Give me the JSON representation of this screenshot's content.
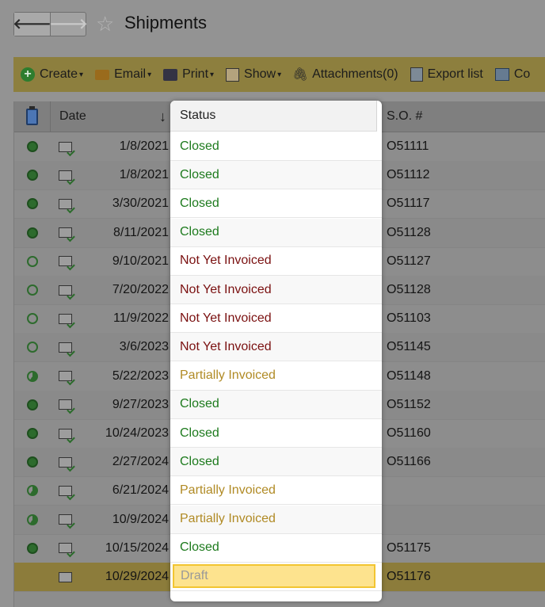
{
  "header": {
    "back_icon": "arrow-left-icon",
    "forward_icon": "arrow-right-icon",
    "back_glyph": "🡐",
    "forward_glyph": "🡒",
    "favorite_icon": "star-icon",
    "star_glyph": "☆",
    "title": "Shipments"
  },
  "toolbar": {
    "create": "Create",
    "email": "Email",
    "print": "Print",
    "show": "Show",
    "attachments": "Attachments(0)",
    "export": "Export list",
    "columns": "Co",
    "caret": "▾",
    "plus_glyph": "+",
    "attach_glyph": "🖇"
  },
  "grid": {
    "columns": {
      "date": "Date",
      "status": "Status",
      "so": "S.O. #"
    },
    "sort_arrow": "↓",
    "rows": [
      {
        "indicator": "full",
        "date": "1/8/2021",
        "status": "Closed",
        "status_kind": "closed",
        "so": "O51111"
      },
      {
        "indicator": "full",
        "date": "1/8/2021",
        "status": "Closed",
        "status_kind": "closed",
        "so": "O51112"
      },
      {
        "indicator": "full",
        "date": "3/30/2021",
        "status": "Closed",
        "status_kind": "closed",
        "so": "O51117"
      },
      {
        "indicator": "full",
        "date": "8/11/2021",
        "status": "Closed",
        "status_kind": "closed",
        "so": "O51128"
      },
      {
        "indicator": "empty",
        "date": "9/10/2021",
        "status": "Not Yet Invoiced",
        "status_kind": "nyi",
        "so": "O51127"
      },
      {
        "indicator": "empty",
        "date": "7/20/2022",
        "status": "Not Yet Invoiced",
        "status_kind": "nyi",
        "so": "O51128"
      },
      {
        "indicator": "empty",
        "date": "11/9/2022",
        "status": "Not Yet Invoiced",
        "status_kind": "nyi",
        "so": "O51103"
      },
      {
        "indicator": "empty",
        "date": "3/6/2023",
        "status": "Not Yet Invoiced",
        "status_kind": "nyi",
        "so": "O51145"
      },
      {
        "indicator": "partial",
        "date": "5/22/2023",
        "status": "Partially Invoiced",
        "status_kind": "partial",
        "so": "O51148"
      },
      {
        "indicator": "full",
        "date": "9/27/2023",
        "status": "Closed",
        "status_kind": "closed",
        "so": "O51152"
      },
      {
        "indicator": "full",
        "date": "10/24/2023",
        "status": "Closed",
        "status_kind": "closed",
        "so": "O51160"
      },
      {
        "indicator": "full",
        "date": "2/27/2024",
        "status": "Closed",
        "status_kind": "closed",
        "so": "O51166"
      },
      {
        "indicator": "partial",
        "date": "6/21/2024",
        "status": "Partially Invoiced",
        "status_kind": "partial",
        "so": ""
      },
      {
        "indicator": "partial",
        "date": "10/9/2024",
        "status": "Partially Invoiced",
        "status_kind": "partial",
        "so": ""
      },
      {
        "indicator": "full",
        "date": "10/15/2024",
        "status": "Closed",
        "status_kind": "closed",
        "so": "O51175"
      },
      {
        "indicator": "none",
        "date": "10/29/2024",
        "status": "Draft",
        "status_kind": "draft",
        "so": "O51176",
        "selected": true
      }
    ]
  },
  "colors": {
    "closed": "#1d7a1d",
    "not_yet_invoiced": "#7a1010",
    "partially_invoiced": "#b08a24",
    "draft": "#999999",
    "selection_fill": "#fde38e"
  }
}
